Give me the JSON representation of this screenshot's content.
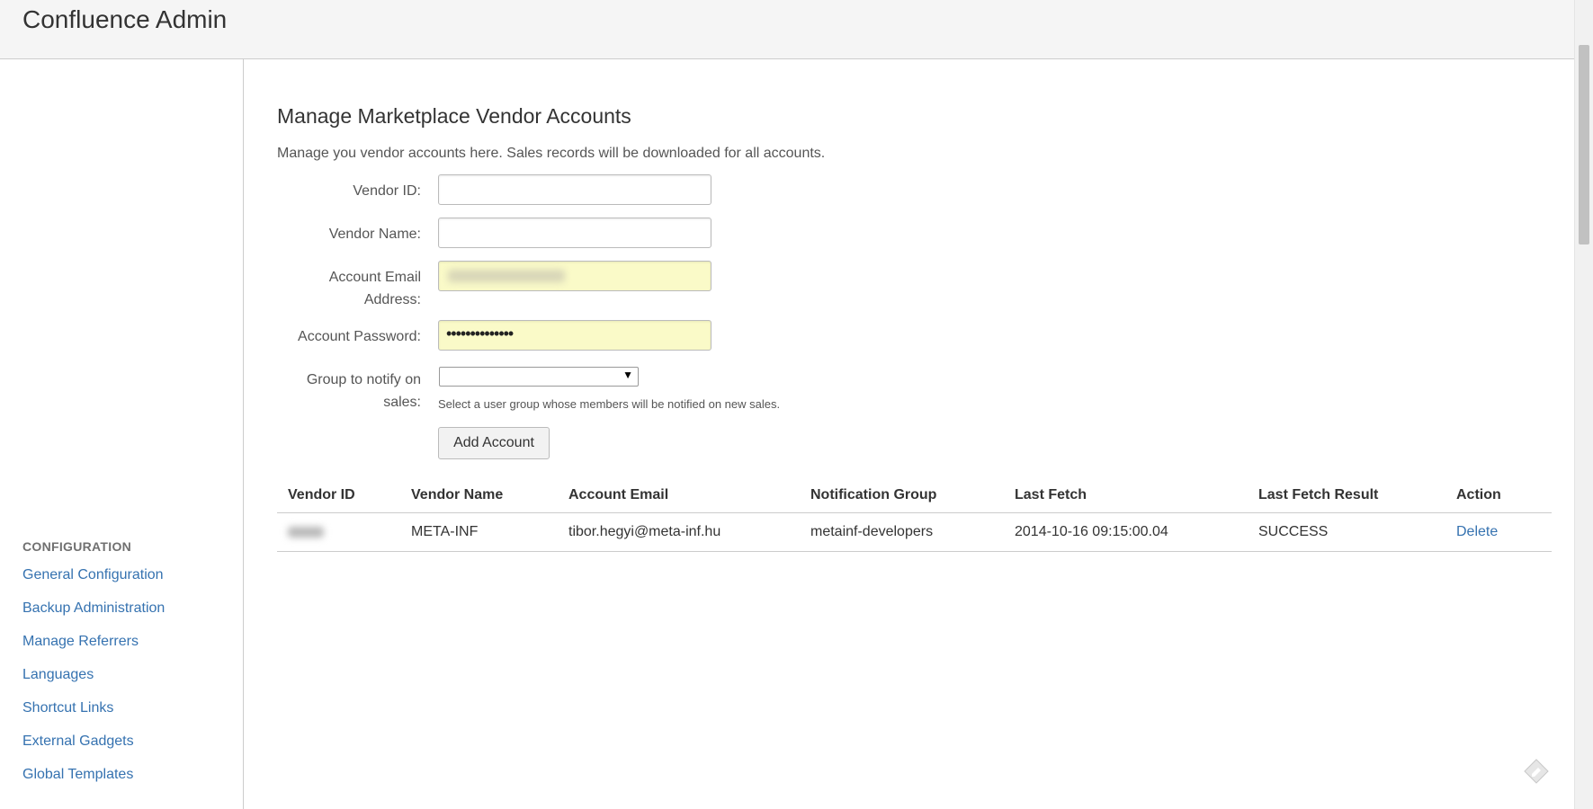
{
  "header": {
    "app_title": "Confluence Admin"
  },
  "sidebar": {
    "section_heading": "CONFIGURATION",
    "items": [
      {
        "label": "General Configuration"
      },
      {
        "label": "Backup Administration"
      },
      {
        "label": "Manage Referrers"
      },
      {
        "label": "Languages"
      },
      {
        "label": "Shortcut Links"
      },
      {
        "label": "External Gadgets"
      },
      {
        "label": "Global Templates"
      }
    ]
  },
  "main": {
    "page_title": "Manage Marketplace Vendor Accounts",
    "description": "Manage you vendor accounts here. Sales records will be downloaded for all accounts.",
    "form": {
      "vendor_id_label": "Vendor ID:",
      "vendor_id_value": "",
      "vendor_name_label": "Vendor Name:",
      "vendor_name_value": "",
      "email_label_line1": "Account Email",
      "email_label_line2": "Address:",
      "password_label": "Account Password:",
      "password_mask": "••••••••••••••",
      "group_label_line1": "Group to notify on",
      "group_label_line2": "sales:",
      "group_selected": "",
      "group_hint": "Select a user group whose members will be notified on new sales.",
      "add_button": "Add Account"
    },
    "table": {
      "headers": [
        "Vendor ID",
        "Vendor Name",
        "Account Email",
        "Notification Group",
        "Last Fetch",
        "Last Fetch Result",
        "Action"
      ],
      "rows": [
        {
          "vendor_name": "META-INF",
          "account_email": "tibor.hegyi@meta-inf.hu",
          "notification_group": "metainf-developers",
          "last_fetch": "2014-10-16 09:15:00.04",
          "last_fetch_result": "SUCCESS",
          "action": "Delete"
        }
      ]
    }
  },
  "colors": {
    "link": "#3572b0",
    "success": "#14892c",
    "autofill_bg": "#fafac8",
    "header_bg": "#f5f5f5"
  },
  "icons": {
    "feedback": "feedback-icon",
    "select_arrow": "chevron-down-icon"
  }
}
